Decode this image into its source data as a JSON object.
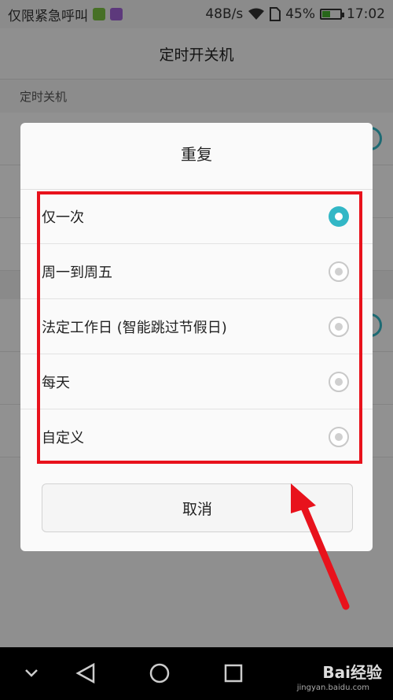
{
  "status_bar": {
    "carrier": "仅限紧急呼叫",
    "speed": "48B/s",
    "battery": "45%",
    "time": "17:02",
    "battery_level": 0.45,
    "icons": [
      "wechat-icon",
      "gallery-icon",
      "wifi-icon",
      "sim-icon",
      "battery-icon"
    ]
  },
  "header": {
    "title": "定时开关机"
  },
  "section": {
    "label": "定时关机"
  },
  "dialog": {
    "title": "重复",
    "options": [
      {
        "label": "仅一次",
        "selected": true
      },
      {
        "label": "周一到周五",
        "selected": false
      },
      {
        "label": "法定工作日 (智能跳过节假日)",
        "selected": false
      },
      {
        "label": "每天",
        "selected": false
      },
      {
        "label": "自定义",
        "selected": false
      }
    ],
    "cancel_label": "取消"
  },
  "nav_bar": {
    "icons": [
      "chevron-down-icon",
      "back-icon",
      "home-icon",
      "recents-icon"
    ],
    "watermark": "Bai经验",
    "watermark_sub": "jingyan.baidu.com"
  },
  "colors": {
    "accent": "#32b7c6",
    "highlight": "#e8121c",
    "overlay": "rgba(0,0,0,0.42)"
  }
}
